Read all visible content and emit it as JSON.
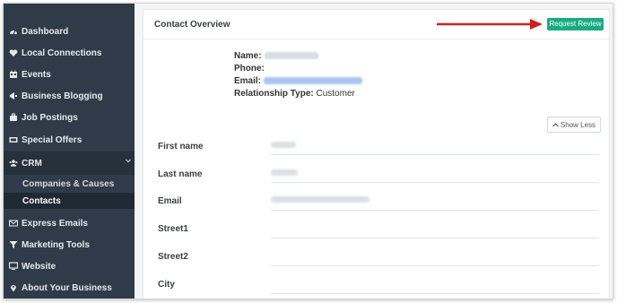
{
  "sidebar": {
    "items": [
      {
        "label": "Dashboard",
        "icon": "dashboard-icon"
      },
      {
        "label": "Local Connections",
        "icon": "heart-icon"
      },
      {
        "label": "Events",
        "icon": "calendar-icon"
      },
      {
        "label": "Business Blogging",
        "icon": "megaphone-icon"
      },
      {
        "label": "Job Postings",
        "icon": "briefcase-icon"
      },
      {
        "label": "Special Offers",
        "icon": "ticket-icon"
      },
      {
        "label": "CRM",
        "icon": "users-icon"
      },
      {
        "label": "Express Emails",
        "icon": "envelope-icon"
      },
      {
        "label": "Marketing Tools",
        "icon": "filter-icon"
      },
      {
        "label": "Website",
        "icon": "monitor-icon"
      },
      {
        "label": "About Your Business",
        "icon": "map-pin-icon"
      }
    ],
    "crm_sub": [
      {
        "label": "Companies & Causes"
      },
      {
        "label": "Contacts"
      }
    ]
  },
  "main": {
    "title": "Contact Overview",
    "request_review": "Request Review",
    "info": {
      "name_label": "Name:",
      "phone_label": "Phone:",
      "email_label": "Email:",
      "relationship_label": "Relationship Type:",
      "relationship_value": "Customer"
    },
    "show_less": "Show Less",
    "fields": [
      {
        "label": "First name"
      },
      {
        "label": "Last name"
      },
      {
        "label": "Email"
      },
      {
        "label": "Street1"
      },
      {
        "label": "Street2"
      },
      {
        "label": "City"
      }
    ]
  },
  "colors": {
    "sidebar_bg": "#2f3b48",
    "accent": "#1aaa84",
    "arrow": "#d11f1f",
    "email_link": "#a9c5f0"
  }
}
